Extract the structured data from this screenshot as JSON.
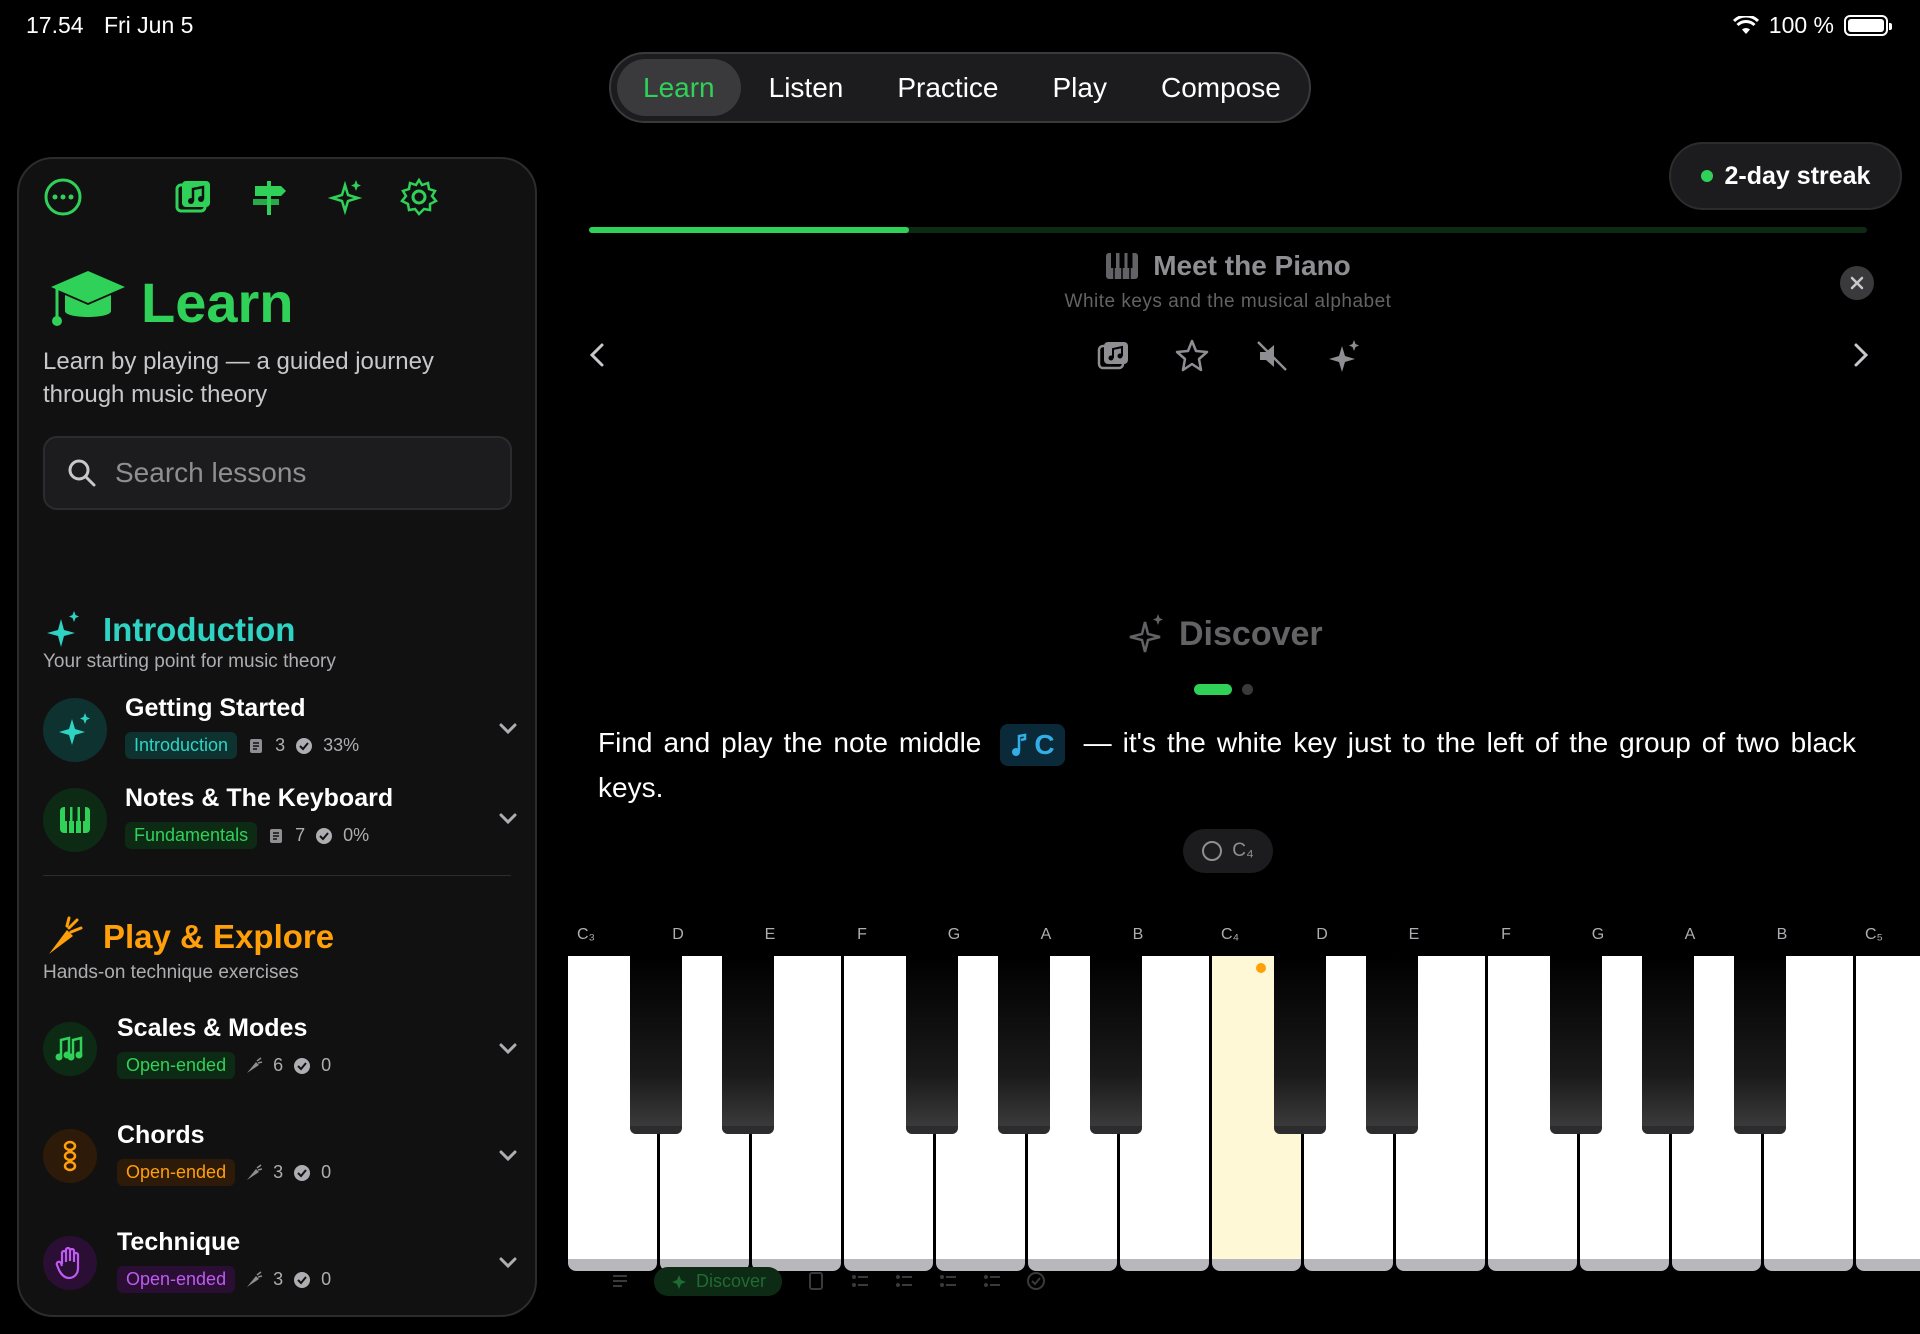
{
  "status": {
    "time": "17.54",
    "date": "Fri Jun 5",
    "battery": "100 %"
  },
  "nav": {
    "tabs": [
      "Learn",
      "Listen",
      "Practice",
      "Play",
      "Compose"
    ],
    "active": "Learn"
  },
  "sidebar": {
    "title": "Learn",
    "subtitle": "Learn by playing — a guided journey through music theory",
    "search_placeholder": "Search lessons",
    "sections": [
      {
        "title": "Introduction",
        "subtitle": "Your starting point for music theory",
        "color": "#2fd3c4",
        "items": [
          {
            "name": "Getting Started",
            "badge": "Introduction",
            "lessons": "3",
            "progress": "33%"
          },
          {
            "name": "Notes & The Keyboard",
            "badge": "Fundamentals",
            "lessons": "7",
            "progress": "0%"
          }
        ]
      },
      {
        "title": "Play & Explore",
        "subtitle": "Hands-on technique exercises",
        "color": "#ff9f0a",
        "items": [
          {
            "name": "Scales & Modes",
            "badge": "Open-ended",
            "count": "6",
            "done": "0"
          },
          {
            "name": "Chords",
            "badge": "Open-ended",
            "count": "3",
            "done": "0"
          },
          {
            "name": "Technique",
            "badge": "Open-ended",
            "count": "3",
            "done": "0"
          }
        ]
      }
    ]
  },
  "streak": "2-day streak",
  "lesson": {
    "title": "Meet the Piano",
    "subtitle": "White keys and the musical alphabet",
    "progress_fraction": 0.25,
    "step": "Discover",
    "instruction_pre": "Find and play the note middle",
    "note": "C",
    "instruction_post": "— it's the white key just to the left of the group of two black keys.",
    "target": "C₄"
  },
  "keyboard": {
    "labels": [
      "C₃",
      "D",
      "E",
      "F",
      "G",
      "A",
      "B",
      "C₄",
      "D",
      "E",
      "F",
      "G",
      "A",
      "B",
      "C₅"
    ],
    "highlighted": "C₄"
  },
  "bottom_bar": {
    "active_label": "Discover"
  },
  "colors": {
    "accent": "#30d158",
    "teal": "#2fd3c4",
    "orange": "#ff9f0a",
    "purple": "#bf5af2"
  }
}
